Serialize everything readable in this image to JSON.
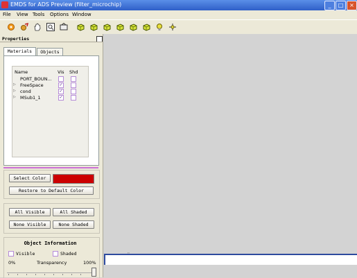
{
  "window": {
    "title": "EMDS for ADS Preview (filter_microchip)"
  },
  "menu": [
    "File",
    "View",
    "Tools",
    "Options",
    "Window"
  ],
  "toolbar": {
    "icons": [
      "open-icon",
      "settings-icon",
      "pan-hand-icon",
      "zoom-fit-icon",
      "rotate-icon",
      "view-front-icon",
      "view-back-icon",
      "view-left-icon",
      "view-right-icon",
      "view-top-icon",
      "view-bottom-icon",
      "light-bulb-icon",
      "pick-point-icon"
    ]
  },
  "panel": {
    "title": "Properties",
    "tabs": [
      "Materials",
      "Objects"
    ],
    "list_headers": {
      "name": "Name",
      "vis": "Vis",
      "shd": "Shd"
    },
    "rows": [
      {
        "name": "PORT_BOUN...",
        "expandable": false,
        "vis": false,
        "shd": false
      },
      {
        "name": "FreeSpace",
        "expandable": true,
        "vis": true,
        "shd": false
      },
      {
        "name": "cond",
        "expandable": true,
        "vis": true,
        "shd": false
      },
      {
        "name": "MSub1_1",
        "expandable": true,
        "vis": true,
        "shd": false
      }
    ],
    "select_color_label": "Select Color",
    "selected_color": "#cc0000",
    "restore_default_label": "Restore to Default Color",
    "all_visible_label": "All Visible",
    "all_shaded_label": "All Shaded",
    "none_visible_label": "None Visible",
    "none_shaded_label": "None Shaded",
    "object_info": {
      "title": "Object Information",
      "visible_label": "Visible",
      "shaded_label": "Shaded",
      "transparency_min": "0%",
      "transparency_label": "Transparency",
      "transparency_max": "100%",
      "transparency_value": 1.0
    }
  },
  "colors": {
    "accent": "#cc6fd6",
    "title_bar": "#2f5fc8",
    "workspace": "#d3d3d3"
  }
}
